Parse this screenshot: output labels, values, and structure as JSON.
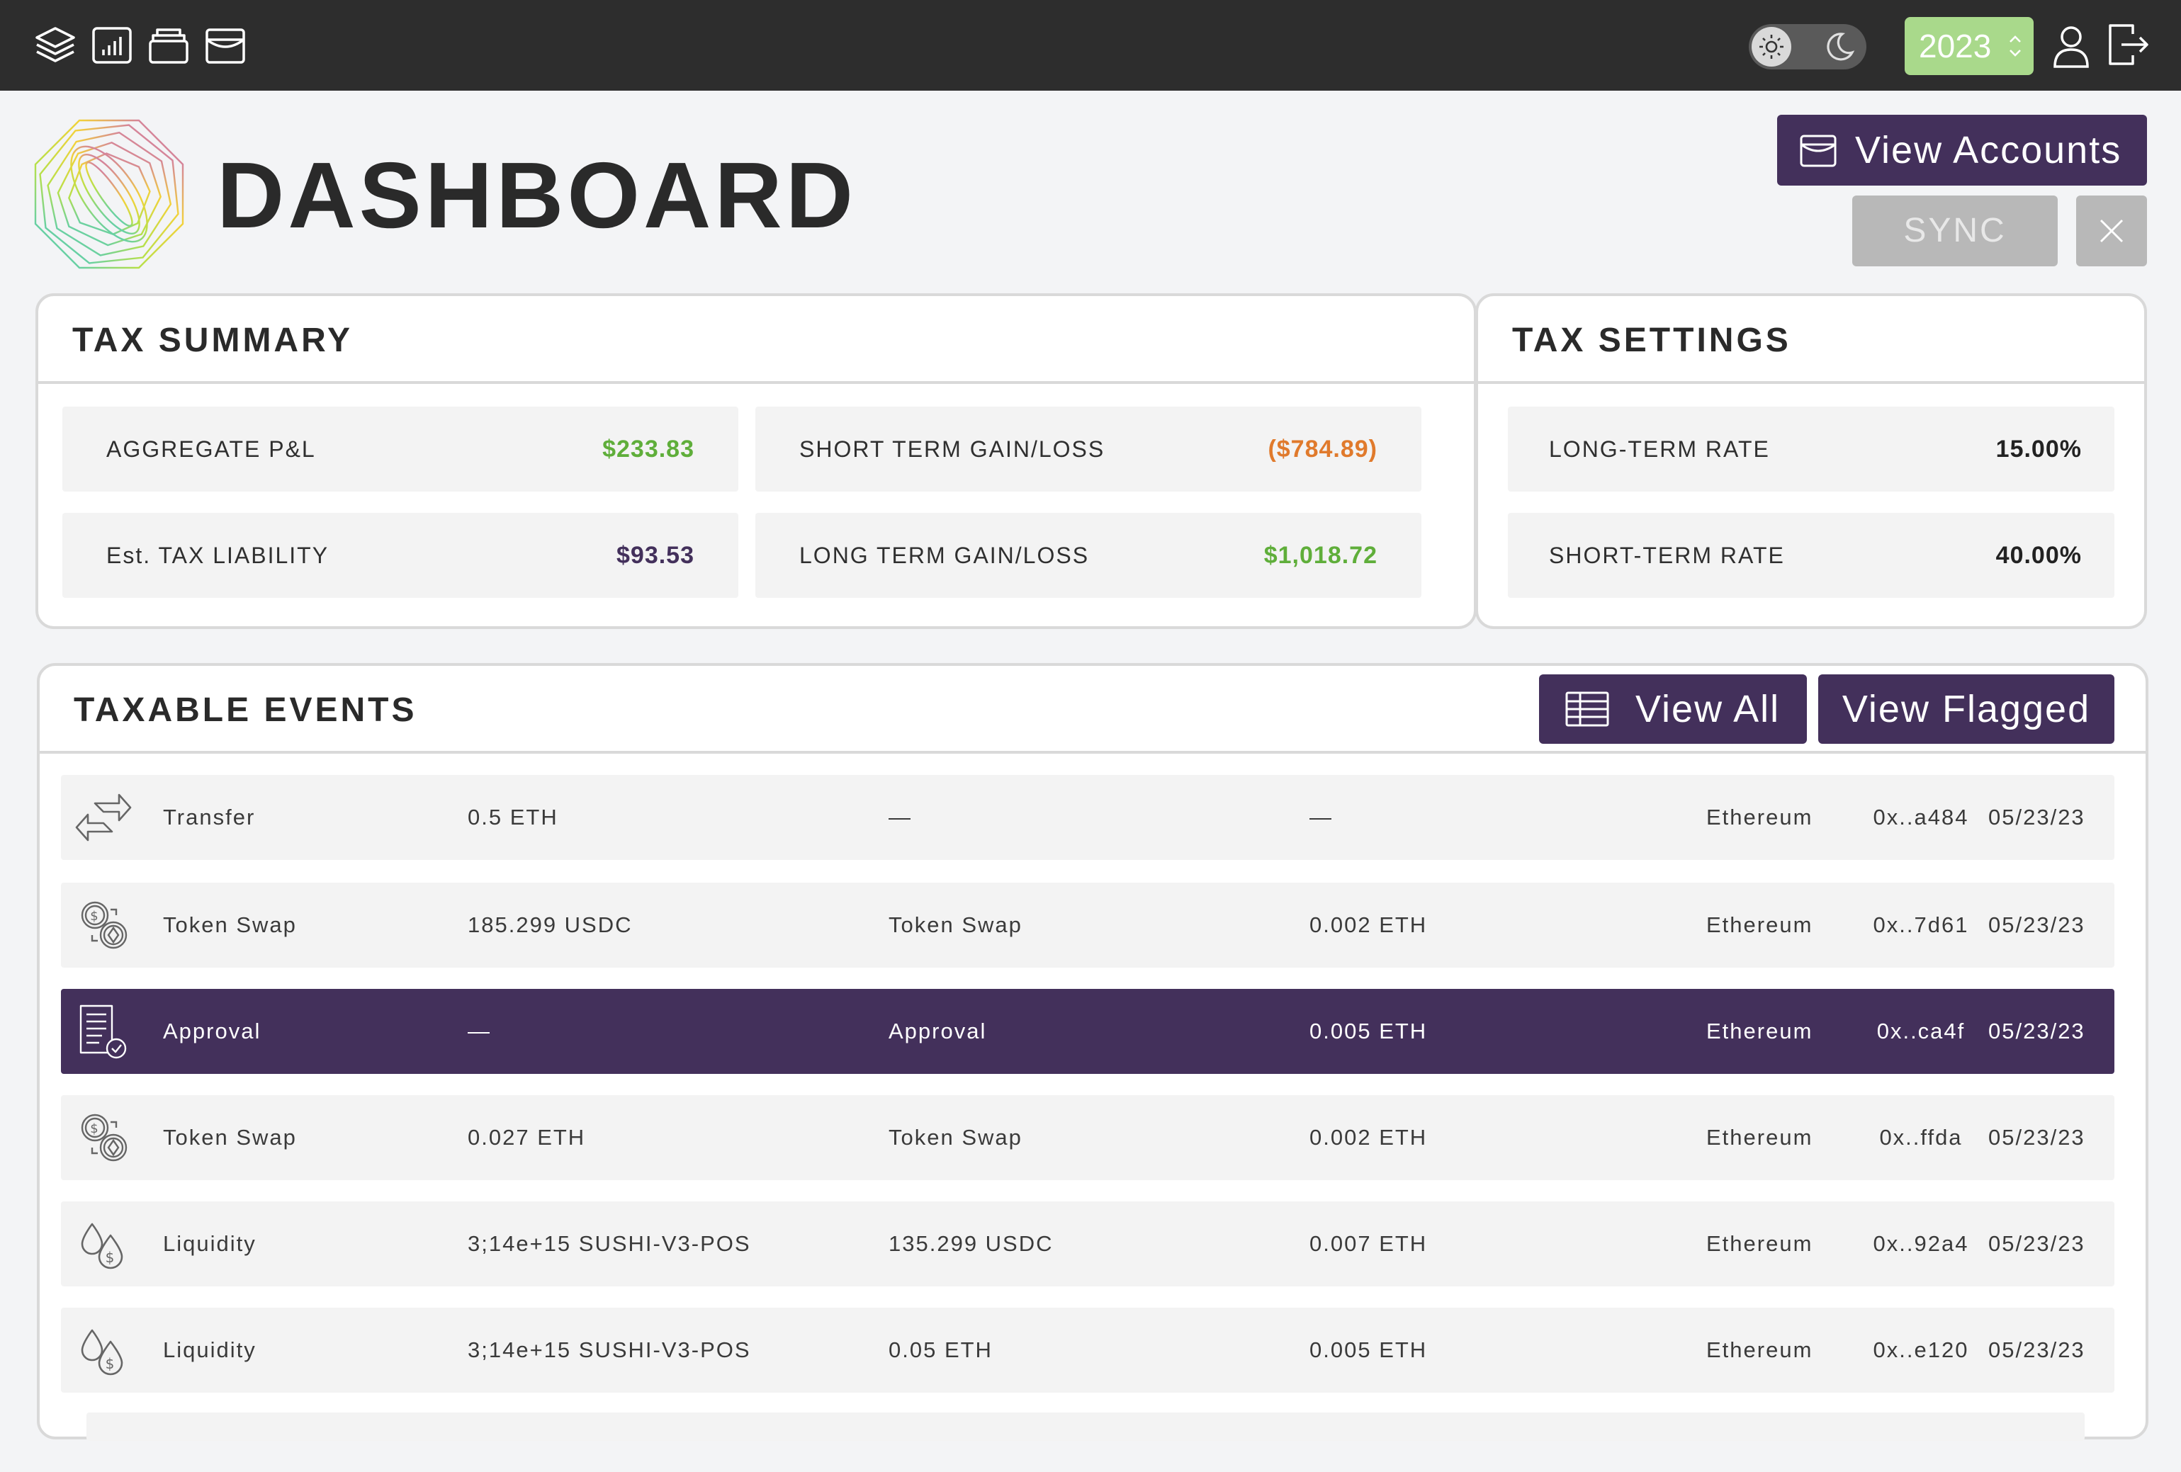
{
  "topbar": {
    "nav_icons": [
      "layers-icon",
      "bar-chart-icon",
      "stack-icon",
      "wallet-icon"
    ],
    "theme_toggle": {
      "left_icon": "sun-icon",
      "right_icon": "moon-icon"
    },
    "year": "2023",
    "user_icon": "user-icon",
    "logout_icon": "logout-icon"
  },
  "header": {
    "logo_icon": "octagon-logo-icon",
    "title": "DASHBOARD",
    "view_accounts_label": "View Accounts",
    "sync_label": "SYNC",
    "close_icon": "close-icon"
  },
  "tax_summary": {
    "title": "TAX SUMMARY",
    "items": [
      {
        "label": "AGGREGATE P&L",
        "value": "$233.83",
        "color": "#5fae3a"
      },
      {
        "label": "SHORT TERM GAIN/LOSS",
        "value": "($784.89)",
        "color": "#e07a2c"
      },
      {
        "label": "Est. TAX LIABILITY",
        "value": "$93.53",
        "color": "#43305b"
      },
      {
        "label": "LONG TERM GAIN/LOSS",
        "value": "$1,018.72",
        "color": "#5fae3a"
      }
    ]
  },
  "tax_settings": {
    "title": "TAX SETTINGS",
    "items": [
      {
        "label": "LONG-TERM RATE",
        "value": "15.00%"
      },
      {
        "label": "SHORT-TERM RATE",
        "value": "40.00%"
      }
    ]
  },
  "taxable_events": {
    "title": "TAXABLE EVENTS",
    "view_all_label": "View All",
    "view_flagged_label": "View Flagged",
    "rows": [
      {
        "icon": "transfer-icon",
        "type": "Transfer",
        "amount": "0.5 ETH",
        "received": "—",
        "fee": "—",
        "chain": "Ethereum",
        "hash": "0x..a484",
        "date": "05/23/23"
      },
      {
        "icon": "token-swap-icon",
        "type": "Token Swap",
        "amount": "185.299 USDC",
        "received": "Token Swap",
        "fee": "0.002 ETH",
        "chain": "Ethereum",
        "hash": "0x..7d61",
        "date": "05/23/23"
      },
      {
        "icon": "approval-document-icon",
        "type": "Approval",
        "amount": "—",
        "received": "Approval",
        "fee": "0.005 ETH",
        "chain": "Ethereum",
        "hash": "0x..ca4f",
        "date": "05/23/23"
      },
      {
        "icon": "token-swap-icon",
        "type": "Token Swap",
        "amount": "0.027 ETH",
        "received": "Token Swap",
        "fee": "0.002 ETH",
        "chain": "Ethereum",
        "hash": "0x..ffda",
        "date": "05/23/23"
      },
      {
        "icon": "liquidity-icon",
        "type": "Liquidity",
        "amount": "3;14e+15 SUSHI-V3-POS",
        "received": "135.299 USDC",
        "fee": "0.007 ETH",
        "chain": "Ethereum",
        "hash": "0x..92a4",
        "date": "05/23/23"
      },
      {
        "icon": "liquidity-icon",
        "type": "Liquidity",
        "amount": "3;14e+15 SUSHI-V3-POS",
        "received": "0.05 ETH",
        "fee": "0.005 ETH",
        "chain": "Ethereum",
        "hash": "0x..e120",
        "date": "05/23/23"
      }
    ]
  },
  "colors": {
    "accent": "#43305b",
    "topbar": "#2d2d2d",
    "year_badge": "#a9d98b",
    "positive": "#5fae3a",
    "negative": "#e07a2c",
    "disabled": "#b8b8b8"
  }
}
